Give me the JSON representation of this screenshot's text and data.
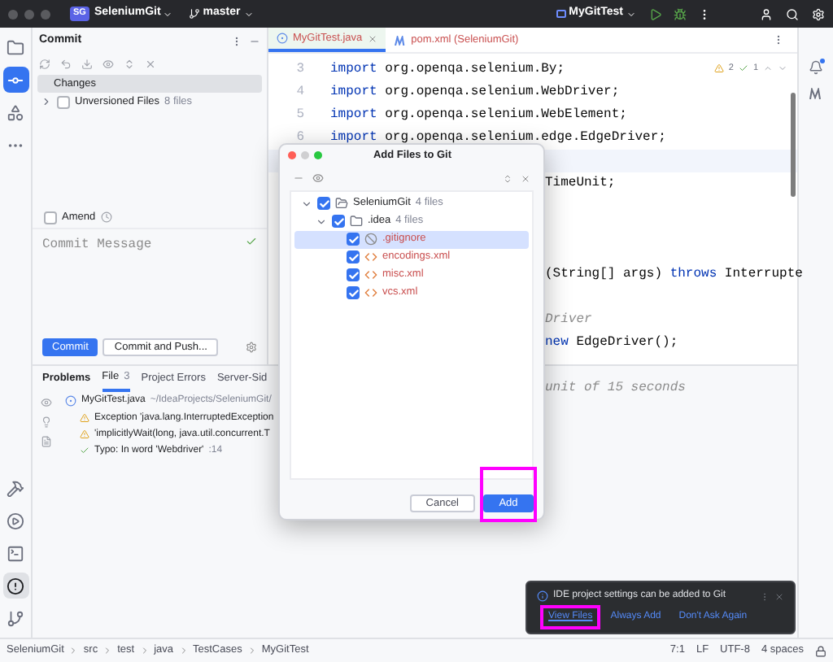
{
  "title_bar": {
    "project_badge": "SG",
    "project": "SeleniumGit",
    "branch": "master",
    "run_config": "MyGitTest"
  },
  "tool_strip": {
    "top": [
      {
        "kind": "folder",
        "selected": false
      },
      {
        "kind": "commit",
        "selected": true
      },
      {
        "kind": "structure",
        "selected": false
      },
      {
        "kind": "more",
        "selected": false
      }
    ],
    "bottom": [
      {
        "kind": "build",
        "selected": false
      },
      {
        "kind": "run",
        "selected": false
      },
      {
        "kind": "terminal",
        "selected": false
      },
      {
        "kind": "problems",
        "selected": true
      },
      {
        "kind": "git",
        "selected": false
      }
    ]
  },
  "commit_panel": {
    "title": "Commit",
    "changes": {
      "label": "Changes",
      "selected": true
    },
    "unversioned": {
      "label": "Unversioned Files",
      "count": "8 files",
      "checked": false
    },
    "amend": {
      "label": "Amend",
      "checked": false
    },
    "message": {
      "placeholder": "Commit Message"
    },
    "buttons": [
      {
        "label": "Commit",
        "kind": "primary"
      },
      {
        "label": "Commit and Push...",
        "kind": "secondary"
      }
    ]
  },
  "editor": {
    "tabs": [
      {
        "label": "MyGitTest.java",
        "kind": "java",
        "selected": true
      },
      {
        "label": "pom.xml (SeleniumGit)",
        "kind": "maven",
        "selected": false
      }
    ],
    "inspections": {
      "warnings": "2",
      "typos": "1"
    },
    "lines": [
      {
        "number": "3",
        "current": false,
        "tokens": [
          {
            "kind": "keyword",
            "text": "import"
          },
          {
            "kind": "plain",
            "text": " org.openqa.selenium.By;"
          }
        ]
      },
      {
        "number": "4",
        "current": false,
        "tokens": [
          {
            "kind": "keyword",
            "text": "import"
          },
          {
            "kind": "plain",
            "text": " org.openqa.selenium.WebDriver;"
          }
        ]
      },
      {
        "number": "5",
        "current": false,
        "tokens": [
          {
            "kind": "keyword",
            "text": "import"
          },
          {
            "kind": "plain",
            "text": " org.openqa.selenium.WebElement;"
          }
        ]
      },
      {
        "number": "6",
        "current": false,
        "tokens": [
          {
            "kind": "keyword",
            "text": "import"
          },
          {
            "kind": "plain",
            "text": " org.openqa.selenium.edge.EdgeDriver;"
          }
        ]
      },
      {
        "current": true
      },
      {
        "current": false,
        "tokens": [
          {
            "kind": "plain",
            "text": "TimeUnit;"
          }
        ]
      },
      {
        "current": false
      },
      {
        "current": false
      },
      {
        "current": false
      },
      {
        "current": false,
        "tokens": [
          {
            "kind": "plain",
            "text": "(String[] args) "
          },
          {
            "kind": "keyword",
            "text": "throws"
          },
          {
            "kind": "plain",
            "text": " Interrupte"
          }
        ]
      },
      {
        "current": false
      },
      {
        "current": false,
        "tokens": [
          {
            "kind": "comment",
            "text": "Driver"
          }
        ]
      },
      {
        "current": false,
        "tokens": [
          {
            "kind": "keyword",
            "text": "new"
          },
          {
            "kind": "plain",
            "text": " EdgeDriver();"
          }
        ]
      },
      {
        "current": false
      },
      {
        "current": false,
        "tokens": [
          {
            "kind": "comment",
            "text": "unit of 15 seconds"
          }
        ]
      }
    ]
  },
  "problems": {
    "title": "Problems",
    "tabs": [
      {
        "label": "File",
        "count": "3",
        "selected": true
      },
      {
        "label": "Project Errors",
        "selected": false
      },
      {
        "label": "Server-Sid",
        "selected": false
      }
    ],
    "file": {
      "name": "MyGitTest.java",
      "path": "~/IdeaProjects/SeleniumGit/"
    },
    "items": [
      {
        "kind": "warning",
        "text": "Exception 'java.lang.InterruptedException"
      },
      {
        "kind": "warning",
        "text": "'implicitlyWait(long, java.util.concurrent.T"
      },
      {
        "kind": "typo",
        "text": "Typo: In word 'Webdriver'",
        "line": ":14"
      }
    ]
  },
  "dialog": {
    "title": "Add Files to Git",
    "tree": [
      {
        "label": "SeleniumGit",
        "count": "4 files",
        "kind": "module",
        "checked": true,
        "expanded": true,
        "selected": false,
        "children": [
          {
            "label": ".idea",
            "count": "4 files",
            "kind": "folder",
            "checked": true,
            "expanded": true,
            "selected": false,
            "children": [
              {
                "label": ".gitignore",
                "kind": "ignored",
                "checked": true,
                "selected": true
              },
              {
                "label": "encodings.xml",
                "kind": "xml",
                "checked": true,
                "selected": false
              },
              {
                "label": "misc.xml",
                "kind": "xml",
                "checked": true,
                "selected": false
              },
              {
                "label": "vcs.xml",
                "kind": "xml",
                "checked": true,
                "selected": false
              }
            ]
          }
        ]
      }
    ],
    "buttons": [
      {
        "label": "Cancel",
        "kind": "secondary",
        "highlighted": false
      },
      {
        "label": "Add",
        "kind": "primary",
        "highlighted": true
      }
    ]
  },
  "notification": {
    "message": "IDE project settings can be added to Git",
    "actions": [
      {
        "label": "View Files",
        "highlighted": true
      },
      {
        "label": "Always Add",
        "highlighted": false
      },
      {
        "label": "Don't Ask Again",
        "highlighted": false
      }
    ]
  },
  "status_bar": {
    "breadcrumbs": [
      "SeleniumGit",
      "src",
      "test",
      "java",
      "TestCases",
      "MyGitTest"
    ],
    "items": [
      "7:1",
      "LF",
      "UTF-8",
      "4 spaces"
    ]
  }
}
